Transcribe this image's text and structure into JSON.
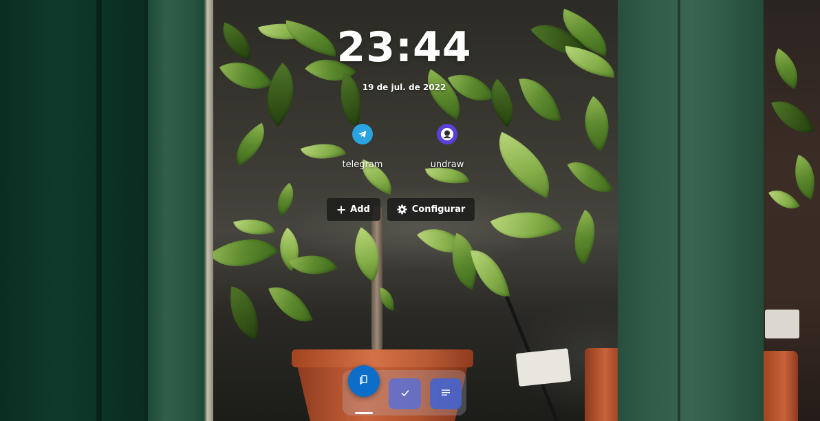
{
  "lockscreen": {
    "time": "23:44",
    "date": "19 de jul. de 2022"
  },
  "shortcuts": [
    {
      "label": "telegram",
      "icon": "telegram-icon",
      "color": "#2aa3e0"
    },
    {
      "label": "undraw",
      "icon": "undraw-icon",
      "color": "#5b3fd6"
    }
  ],
  "actions": {
    "add_label": "Add",
    "add_icon": "plus-icon",
    "configure_label": "Configurar",
    "configure_icon": "gear-icon"
  },
  "dock": {
    "apps": [
      {
        "icon": "bookmarks-icon",
        "color": "#0c6ec8"
      },
      {
        "icon": "check-icon",
        "color": "#5c6ed2"
      },
      {
        "icon": "notes-icon",
        "color": "#4664cd"
      }
    ]
  }
}
